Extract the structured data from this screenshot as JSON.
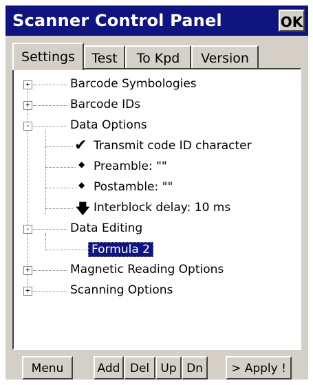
{
  "window": {
    "title": "Scanner Control Panel",
    "ok_label": "OK"
  },
  "tabs": [
    {
      "label": "Settings",
      "active": true
    },
    {
      "label": "Test",
      "active": false
    },
    {
      "label": "To Kpd",
      "active": false
    },
    {
      "label": "Version",
      "active": false
    }
  ],
  "tree": {
    "items": [
      {
        "label": "Barcode Symbologies",
        "expander": "+"
      },
      {
        "label": "Barcode IDs",
        "expander": "+"
      },
      {
        "label": "Data Options",
        "expander": "-"
      },
      {
        "label": "Transmit code ID character",
        "icon": "checkmark-icon"
      },
      {
        "label": "Preamble: \"\"",
        "icon": "diamond-bullet-icon"
      },
      {
        "label": "Postamble: \"\"",
        "icon": "diamond-bullet-icon"
      },
      {
        "label": "Interblock delay: 10 ms",
        "icon": "down-arrow-icon"
      },
      {
        "label": "Data Editing",
        "expander": "-"
      },
      {
        "label": "Formula 2",
        "selected": true
      },
      {
        "label": "Magnetic Reading Options",
        "expander": "+"
      },
      {
        "label": "Scanning Options",
        "expander": "+"
      }
    ]
  },
  "buttons": {
    "menu": "Menu",
    "add": "Add",
    "del": "Del",
    "up": "Up",
    "dn": "Dn",
    "apply": "> Apply !"
  },
  "colors": {
    "titlebar": "#10147e",
    "panel": "#d4d0c8",
    "selection": "#10147e"
  }
}
